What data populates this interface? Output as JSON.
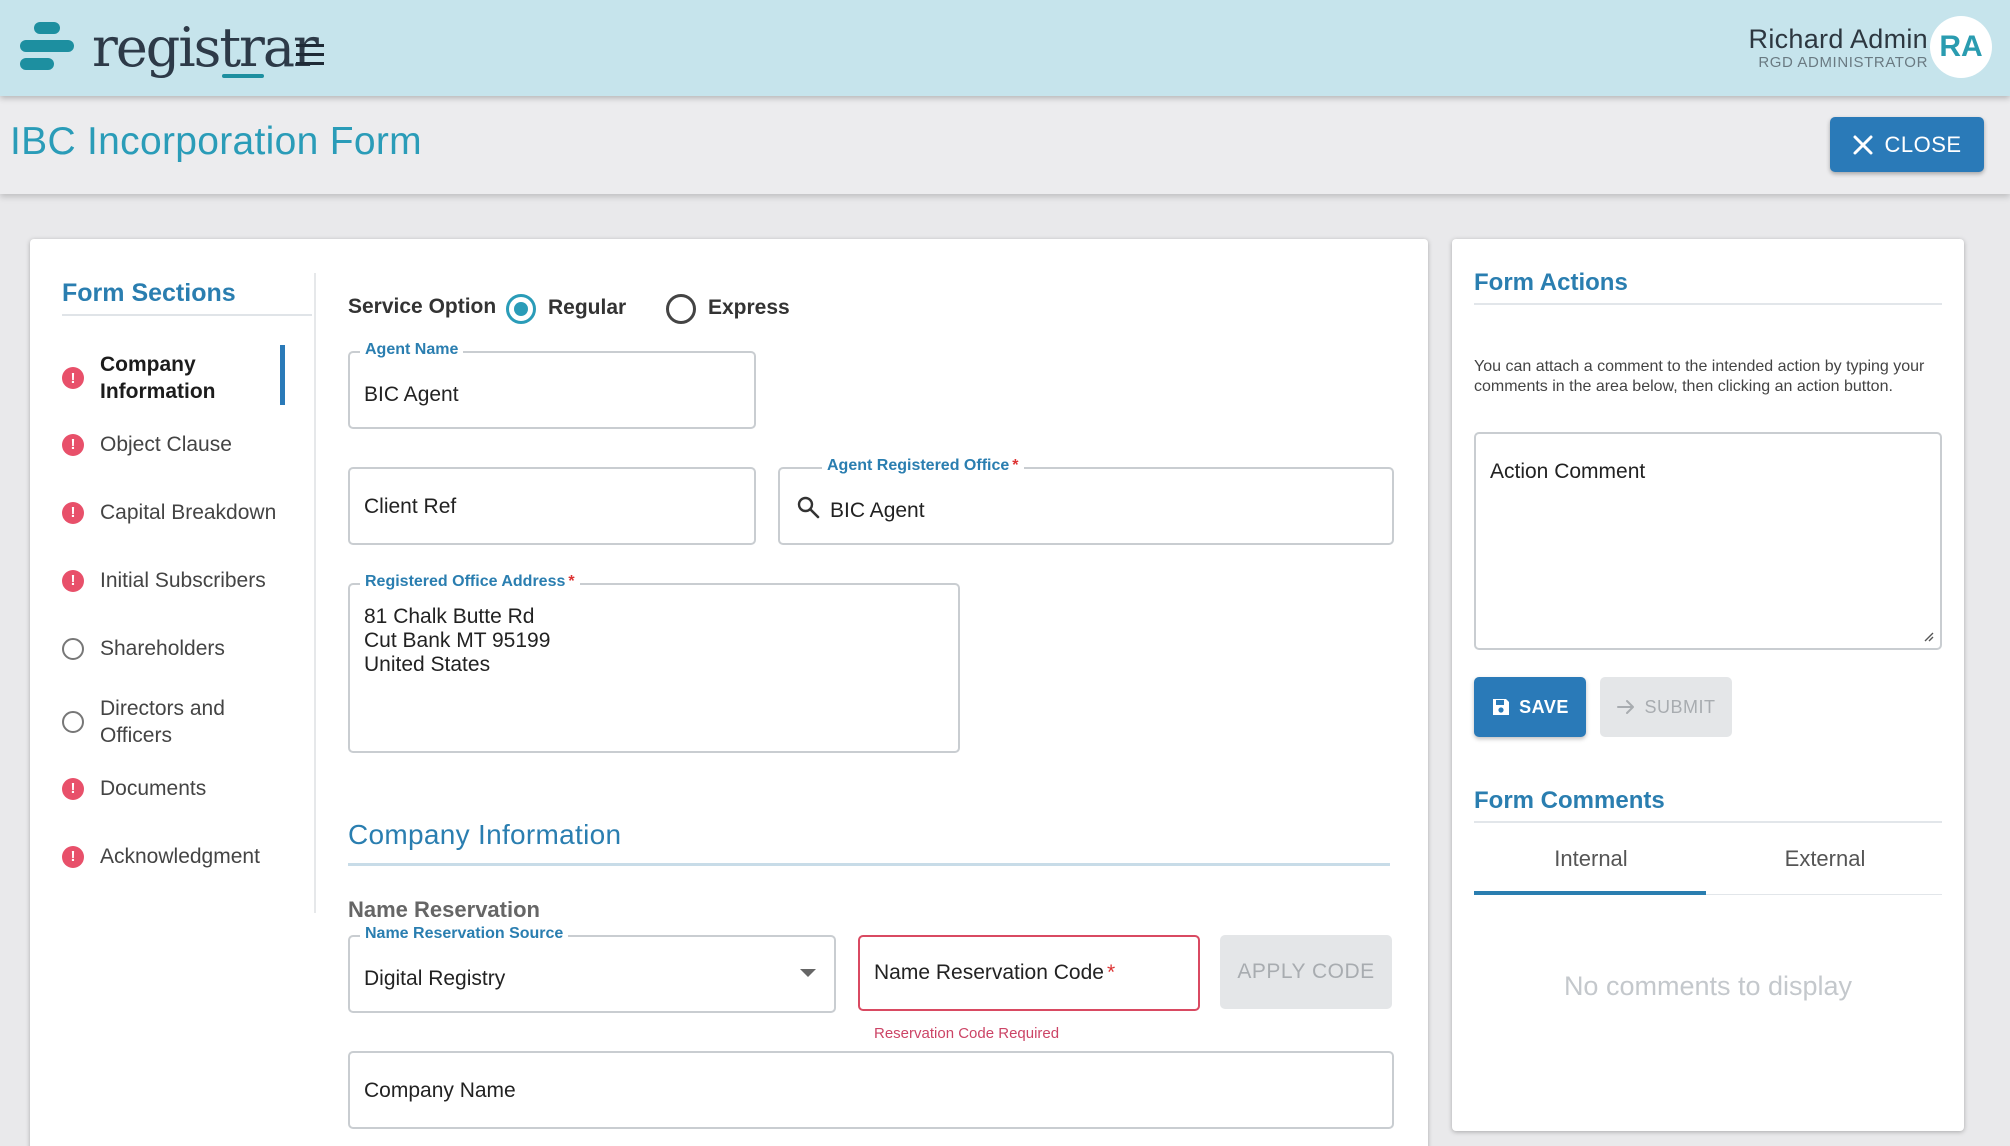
{
  "app": {
    "logo_text": "registrar",
    "page_title": "IBC Incorporation Form",
    "close_label": "CLOSE"
  },
  "user": {
    "name": "Richard Admin",
    "role": "RGD ADMINISTRATOR",
    "initials": "RA"
  },
  "sections": {
    "title": "Form Sections",
    "items": [
      {
        "label": "Company Information",
        "status": "error",
        "active": true
      },
      {
        "label": "Object Clause",
        "status": "error"
      },
      {
        "label": "Capital Breakdown",
        "status": "error"
      },
      {
        "label": "Initial Subscribers",
        "status": "error"
      },
      {
        "label": "Shareholders",
        "status": "empty"
      },
      {
        "label": "Directors and Officers",
        "status": "empty"
      },
      {
        "label": "Documents",
        "status": "error"
      },
      {
        "label": "Acknowledgment",
        "status": "error"
      }
    ]
  },
  "form": {
    "service_option_label": "Service Option",
    "service_options": [
      "Regular",
      "Express"
    ],
    "service_selected": "Regular",
    "agent_name": {
      "label": "Agent Name",
      "value": "BIC Agent"
    },
    "client_ref": {
      "placeholder": "Client Ref"
    },
    "agent_office": {
      "label": "Agent Registered Office",
      "required": "*",
      "value": "BIC Agent"
    },
    "office_address": {
      "label": "Registered Office Address",
      "required": "*",
      "value": "81 Chalk Butte Rd\nCut Bank MT 95199\nUnited States"
    },
    "company_heading": "Company Information",
    "name_reservation_heading": "Name Reservation",
    "nr_source": {
      "label": "Name Reservation Source",
      "value": "Digital Registry"
    },
    "nr_code": {
      "placeholder": "Name Reservation Code",
      "required": "*",
      "error": "Reservation Code Required"
    },
    "apply_code_label": "APPLY CODE",
    "company_name": {
      "placeholder": "Company Name"
    }
  },
  "actions": {
    "title": "Form Actions",
    "help_text": "You can attach a comment to the intended action by typing your comments in the area below, then clicking an action button.",
    "comment_placeholder": "Action Comment",
    "save_label": "SAVE",
    "submit_label": "SUBMIT"
  },
  "comments": {
    "title": "Form Comments",
    "tabs": [
      "Internal",
      "External"
    ],
    "active_tab": "Internal",
    "empty_text": "No comments to display"
  },
  "colors": {
    "topbar": "#c6e4ec",
    "accent": "#2a7ab8",
    "title": "#2a9cb8",
    "error": "#e8506a"
  }
}
